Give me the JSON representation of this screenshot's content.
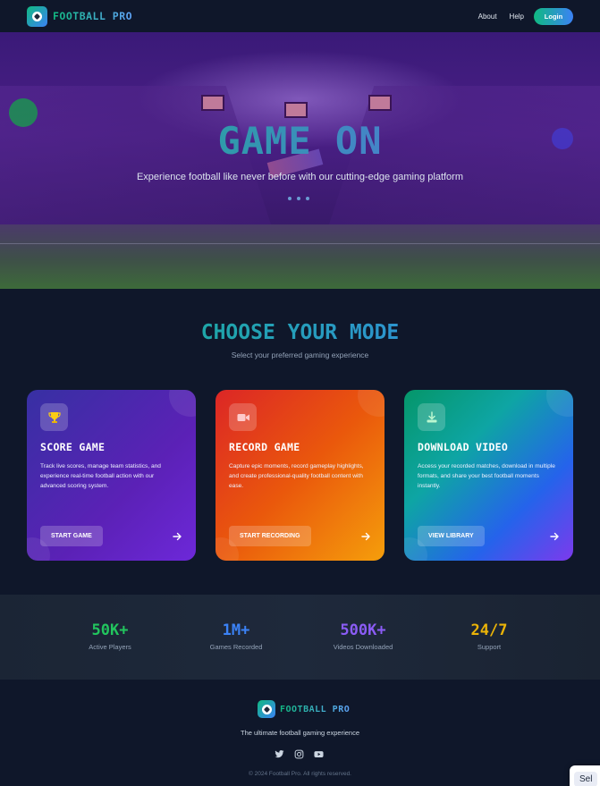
{
  "nav": {
    "brand": "FOOTBALL PRO",
    "links": [
      "About",
      "Help"
    ],
    "login_label": "Login"
  },
  "hero": {
    "title": "GAME ON",
    "subtitle": "Experience football like never before with our cutting-edge gaming platform"
  },
  "modes": {
    "title": "CHOOSE YOUR MODE",
    "subtitle": "Select your preferred gaming experience",
    "cards": [
      {
        "icon": "trophy-icon",
        "title": "SCORE GAME",
        "description": "Track live scores, manage team statistics, and experience real-time football action with our advanced scoring system.",
        "button": "START GAME"
      },
      {
        "icon": "video-camera-icon",
        "title": "RECORD GAME",
        "description": "Capture epic moments, record gameplay highlights, and create professional-quality football content with ease.",
        "button": "START RECORDING"
      },
      {
        "icon": "download-icon",
        "title": "DOWNLOAD VIDEO",
        "description": "Access your recorded matches, download in multiple formats, and share your best football moments instantly.",
        "button": "VIEW LIBRARY"
      }
    ]
  },
  "stats": [
    {
      "value": "50K+",
      "label": "Active Players",
      "color": "#22c55e"
    },
    {
      "value": "1M+",
      "label": "Games Recorded",
      "color": "#3b82f6"
    },
    {
      "value": "500K+",
      "label": "Videos Downloaded",
      "color": "#8b5cf6"
    },
    {
      "value": "24/7",
      "label": "Support",
      "color": "#eab308"
    }
  ],
  "footer": {
    "brand": "FOOTBALL PRO",
    "tagline": "The ultimate football gaming experience",
    "socials": [
      "twitter-icon",
      "instagram-icon",
      "youtube-icon"
    ],
    "copyright": "© 2024 Football Pro. All rights reserved."
  },
  "popup": {
    "label": "Sel"
  },
  "colors": {
    "background": "#0f172a",
    "accent_green": "#10b981",
    "accent_blue": "#3b82f6"
  }
}
